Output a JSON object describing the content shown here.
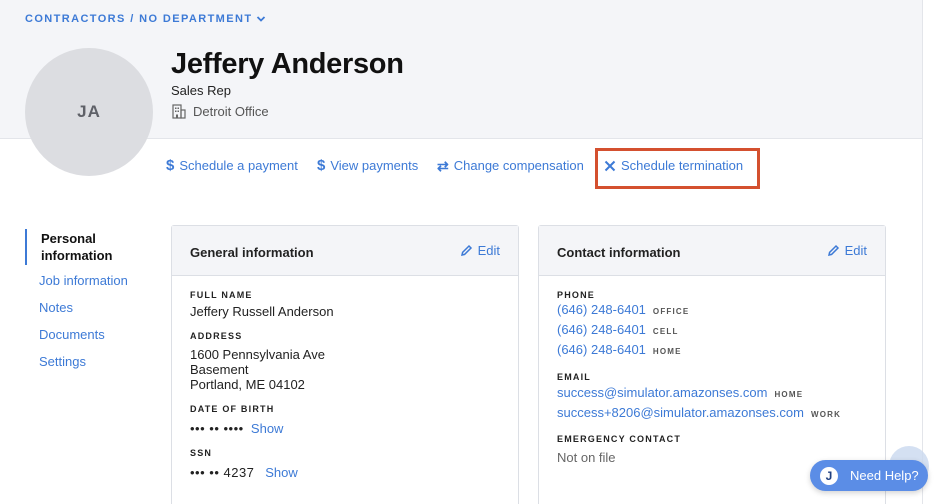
{
  "breadcrumb": {
    "label": "CONTRACTORS / NO DEPARTMENT"
  },
  "profile": {
    "initials": "JA",
    "name": "Jeffery Anderson",
    "title": "Sales Rep",
    "office": "Detroit Office"
  },
  "actions": {
    "schedule_payment": "Schedule a payment",
    "view_payments": "View payments",
    "change_compensation": "Change compensation",
    "schedule_termination": "Schedule termination"
  },
  "sidenav": [
    {
      "label": "Personal information",
      "active": true
    },
    {
      "label": "Job information"
    },
    {
      "label": "Notes"
    },
    {
      "label": "Documents"
    },
    {
      "label": "Settings"
    }
  ],
  "general": {
    "title": "General information",
    "edit": "Edit",
    "full_name_label": "FULL NAME",
    "full_name": "Jeffery Russell Anderson",
    "address_label": "ADDRESS",
    "address_line1": "1600 Pennsylvania Ave",
    "address_line2": "Basement",
    "address_line3": "Portland, ME 04102",
    "dob_label": "DATE OF BIRTH",
    "dob_masked": "••• •• ••••",
    "dob_show": "Show",
    "ssn_label": "SSN",
    "ssn_masked": "••• •• 4237",
    "ssn_show": "Show"
  },
  "contact": {
    "title": "Contact information",
    "edit": "Edit",
    "phone_label": "PHONE",
    "phones": [
      {
        "number": "(646) 248-6401",
        "type": "OFFICE"
      },
      {
        "number": "(646) 248-6401",
        "type": "CELL"
      },
      {
        "number": "(646) 248-6401",
        "type": "HOME"
      }
    ],
    "email_label": "EMAIL",
    "emails": [
      {
        "address": "success@simulator.amazonses.com",
        "type": "HOME"
      },
      {
        "address": "success+8206@simulator.amazonses.com",
        "type": "WORK"
      }
    ],
    "emergency_label": "EMERGENCY CONTACT",
    "emergency_value": "Not on file"
  },
  "help": {
    "initial": "J",
    "label": "Need Help?"
  },
  "colors": {
    "accent": "#3d7ad6",
    "highlight": "#d4502f",
    "header_bg": "#f4f5f8"
  }
}
